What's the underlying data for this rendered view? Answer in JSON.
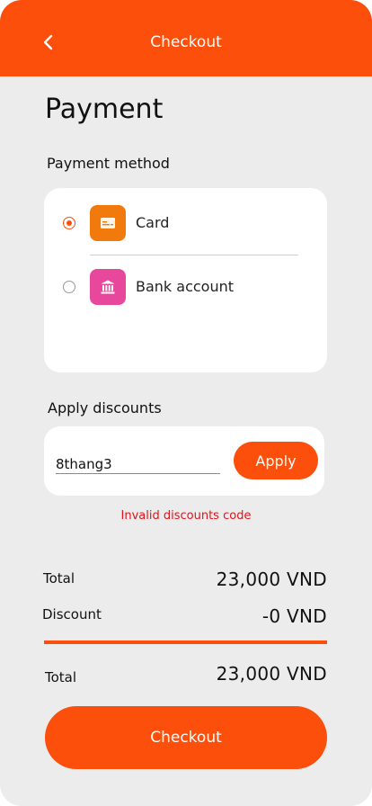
{
  "header": {
    "title": "Checkout",
    "back_icon": "chevron-left-icon"
  },
  "page": {
    "title": "Payment"
  },
  "payment_method": {
    "label": "Payment method",
    "options": [
      {
        "label": "Card",
        "icon": "card-icon",
        "icon_color": "#f2790b",
        "selected": true
      },
      {
        "label": "Bank account",
        "icon": "bank-icon",
        "icon_color": "#e8489b",
        "selected": false
      }
    ]
  },
  "discounts": {
    "label": "Apply discounts",
    "code_value": "8thang3",
    "apply_label": "Apply",
    "error": "Invalid discounts code"
  },
  "summary": {
    "subtotal_label": "Total",
    "subtotal_value": "23,000 VND",
    "discount_label": "Discount",
    "discount_value": "-0 VND",
    "total_label": "Total",
    "total_value": "23,000 VND"
  },
  "checkout": {
    "label": "Checkout"
  },
  "colors": {
    "accent": "#fc4f0c",
    "error": "#e0141b",
    "background": "#ececec"
  }
}
